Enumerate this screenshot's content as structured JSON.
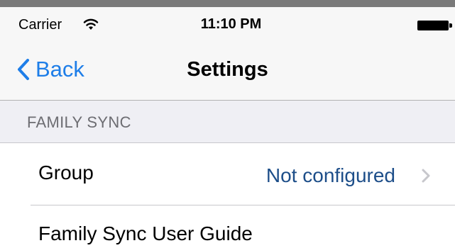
{
  "status_bar": {
    "carrier": "Carrier",
    "time": "11:10 PM",
    "wifi_icon": "wifi-icon",
    "battery_icon": "battery-icon"
  },
  "nav": {
    "back_label": "Back",
    "title": "Settings",
    "back_icon": "chevron-left-icon"
  },
  "section": {
    "header": "FAMILY SYNC"
  },
  "rows": [
    {
      "label": "Group",
      "value": "Not configured",
      "accessory": "chevron-right-icon"
    },
    {
      "label": "Family Sync User Guide"
    }
  ],
  "colors": {
    "accent": "#1e7ee8",
    "value_text": "#1d4e89",
    "section_background": "#efeff4",
    "nav_background": "#f7f7f7"
  }
}
